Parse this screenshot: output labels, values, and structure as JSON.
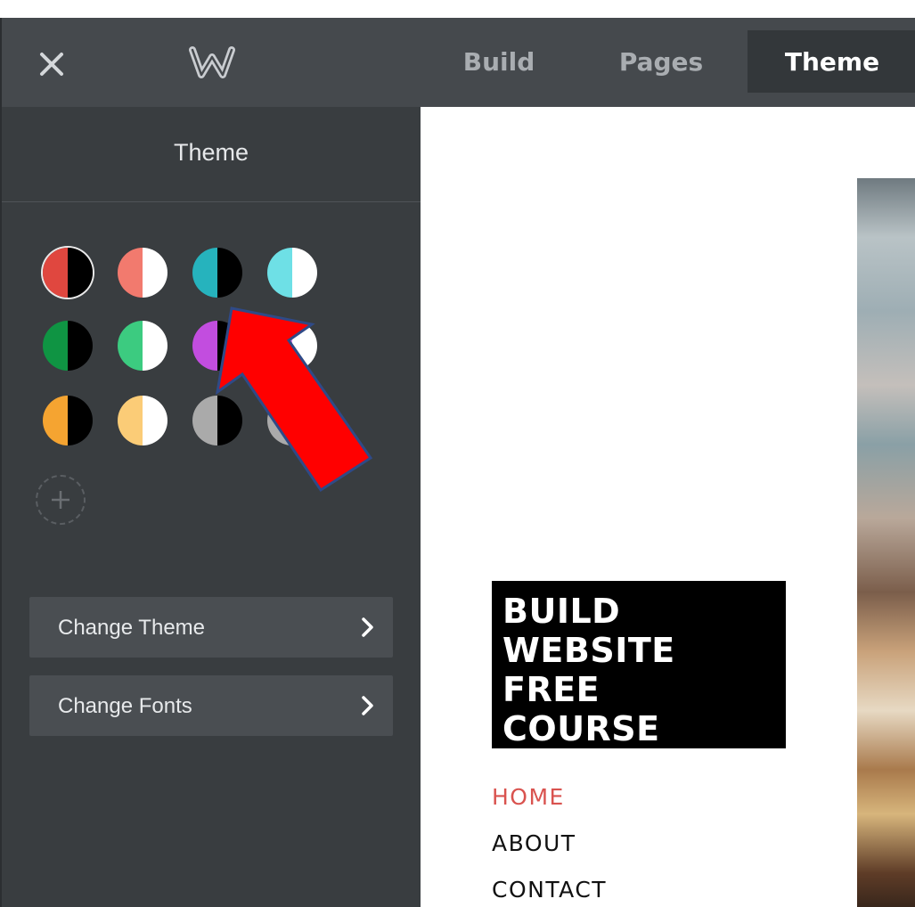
{
  "topbar": {
    "close_icon": "close-icon",
    "logo_icon": "weebly-logo-icon",
    "tabs": [
      {
        "label": "Build",
        "active": false
      },
      {
        "label": "Pages",
        "active": false
      },
      {
        "label": "Theme",
        "active": true
      }
    ]
  },
  "sidebar": {
    "title": "Theme",
    "swatches": [
      {
        "left": "#e0473f",
        "right": "#000000",
        "selected": true
      },
      {
        "left": "#f27a6e",
        "right": "#ffffff",
        "selected": false
      },
      {
        "left": "#26b3bd",
        "right": "#000000",
        "selected": false
      },
      {
        "left": "#6ee0e6",
        "right": "#ffffff",
        "selected": false
      },
      {
        "left": "#0f9443",
        "right": "#000000",
        "selected": false
      },
      {
        "left": "#3ccb80",
        "right": "#ffffff",
        "selected": false
      },
      {
        "left": "#c24ddf",
        "right": "#000000",
        "selected": false
      },
      {
        "left": "#d98be8",
        "right": "#ffffff",
        "selected": false
      },
      {
        "left": "#f5a431",
        "right": "#000000",
        "selected": false
      },
      {
        "left": "#fbcc77",
        "right": "#ffffff",
        "selected": false
      },
      {
        "left": "#aaaaaa",
        "right": "#000000",
        "selected": false
      },
      {
        "left": "#aaaaaa",
        "right": "#ffffff",
        "selected": false
      }
    ],
    "add_icon": "plus-icon",
    "menu": [
      {
        "label": "Change Theme",
        "icon": "chevron-right-icon"
      },
      {
        "label": "Change Fonts",
        "icon": "chevron-right-icon"
      }
    ]
  },
  "preview": {
    "site_title_lines": [
      "BUILD",
      "WEBSITE",
      "FREE",
      "COURSE"
    ],
    "nav": [
      {
        "label": "HOME",
        "active": true
      },
      {
        "label": "ABOUT",
        "active": false
      },
      {
        "label": "CONTACT",
        "active": false
      }
    ],
    "colors": {
      "active_nav": "#d9534f"
    }
  },
  "annotation": {
    "arrow_color": "#ff0000",
    "arrow_outline": "#2f4a87"
  }
}
